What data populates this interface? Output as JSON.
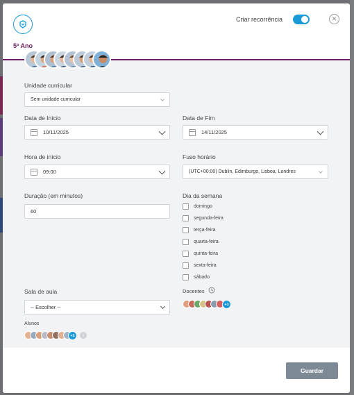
{
  "header": {
    "class_title": "5º Ano",
    "recurrence_label": "Criar recorrência",
    "recurrence_enabled": true,
    "close_glyph": "✕"
  },
  "form": {
    "curricular_unit": {
      "label": "Unidade curricular",
      "value": "Sem unidade curricular"
    },
    "start_date": {
      "label": "Data de Início",
      "value": "10/11/2025"
    },
    "end_date": {
      "label": "Data de Fim",
      "value": "14/11/2025"
    },
    "start_time": {
      "label": "Hora de início",
      "value": "09:00"
    },
    "timezone": {
      "label": "Fuso horário",
      "value": "(UTC+00:00) Dublin, Edimburgo, Lisboa, Londres"
    },
    "duration": {
      "label": "Duração (em minutos)",
      "value": "60"
    },
    "weekday": {
      "label": "Dia da semana",
      "days": [
        "domingo",
        "segunda-feira",
        "terça-feira",
        "quarta-feira",
        "quinta-feira",
        "sexta-feira",
        "sábado"
      ]
    },
    "classroom": {
      "label": "Sala de aula",
      "value": "-- Escolher --"
    },
    "teachers": {
      "label": "Docentes",
      "more": "+1"
    },
    "students": {
      "label": "Alunos",
      "more": "+1",
      "info_glyph": "i"
    }
  },
  "footer": {
    "save_label": "Guardar"
  },
  "colors": {
    "accent": "#1a9bd7",
    "brand": "#6b1f5e",
    "button": "#7d8a96",
    "panel": "#f1f3f5"
  },
  "icons": [
    "logo-icon",
    "close-icon",
    "calendar-icon",
    "chevron-down-icon",
    "clock-icon",
    "info-icon"
  ]
}
